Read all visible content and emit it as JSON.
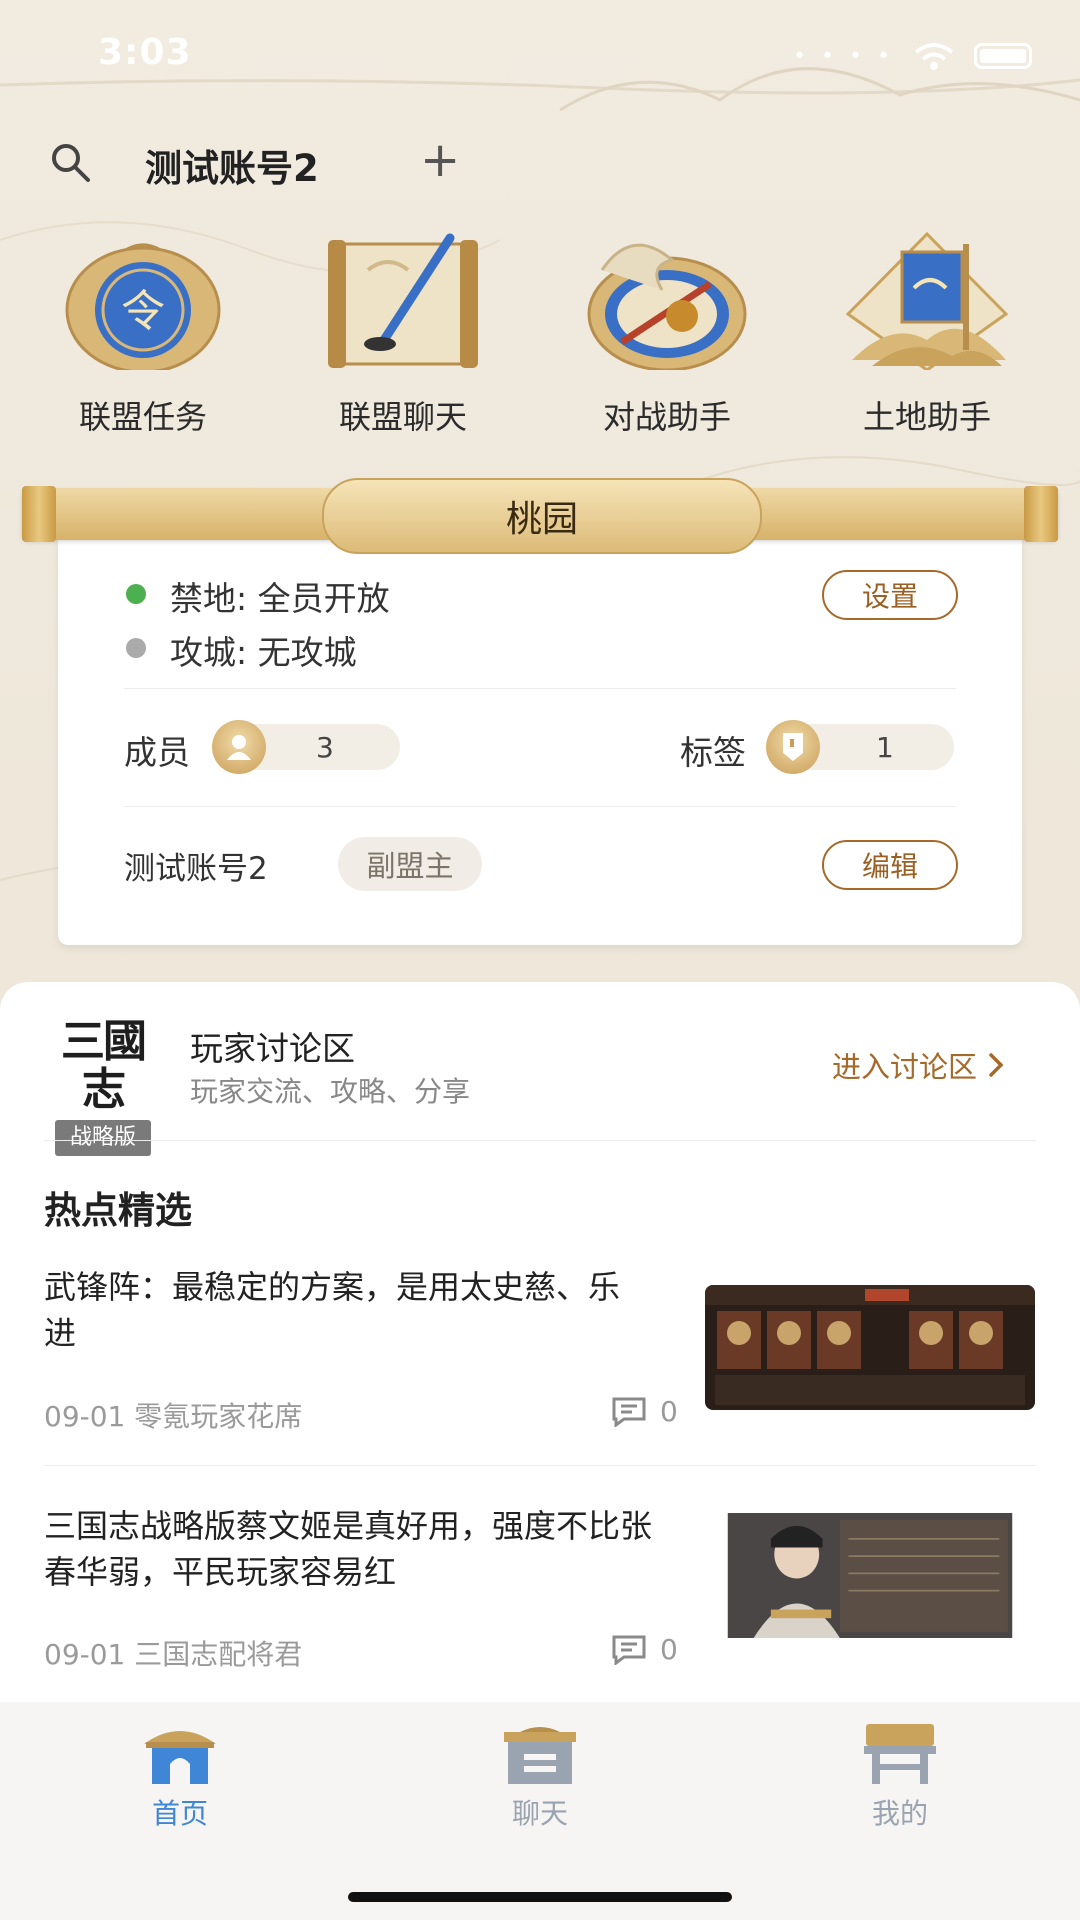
{
  "status": {
    "time": "3:03"
  },
  "header": {
    "account": "测试账号2",
    "add_icon": "plus-icon",
    "search_icon": "search-icon"
  },
  "features": [
    {
      "label": "联盟任务",
      "icon": "alliance-task-icon"
    },
    {
      "label": "联盟聊天",
      "icon": "alliance-chat-icon"
    },
    {
      "label": "对战助手",
      "icon": "battle-assistant-icon"
    },
    {
      "label": "土地助手",
      "icon": "land-assistant-icon"
    }
  ],
  "alliance": {
    "name": "桃园",
    "forbidden": {
      "label": "禁地:",
      "value": "全员开放",
      "color": "#4caf50"
    },
    "siege": {
      "label": "攻城:",
      "value": "无攻城",
      "color": "#aaaaaa"
    },
    "settings_button": "设置",
    "members_label": "成员",
    "members_count": "3",
    "tags_label": "标签",
    "tags_count": "1",
    "user_name": "测试账号2",
    "user_role": "副盟主",
    "edit_button": "编辑"
  },
  "forum": {
    "logo_line1": "三國志",
    "logo_line2": "战略版",
    "title": "玩家讨论区",
    "subtitle": "玩家交流、攻略、分享",
    "enter_label": "进入讨论区"
  },
  "hot": {
    "title": "热点精选",
    "articles": [
      {
        "title": "武锋阵：最稳定的方案，是用太史慈、乐进",
        "meta": "09-01 零氪玩家花席",
        "comments": "0"
      },
      {
        "title": "三国志战略版蔡文姬是真好用，强度不比张春华弱，平民玩家容易红",
        "meta": "09-01 三国志配将君",
        "comments": "0"
      }
    ]
  },
  "tabs": [
    {
      "label": "首页",
      "active": true
    },
    {
      "label": "聊天",
      "active": false
    },
    {
      "label": "我的",
      "active": false
    }
  ],
  "colors": {
    "accent": "#a5692a",
    "tab_active": "#3f86d6",
    "tab_inactive": "#9aa3b0"
  }
}
